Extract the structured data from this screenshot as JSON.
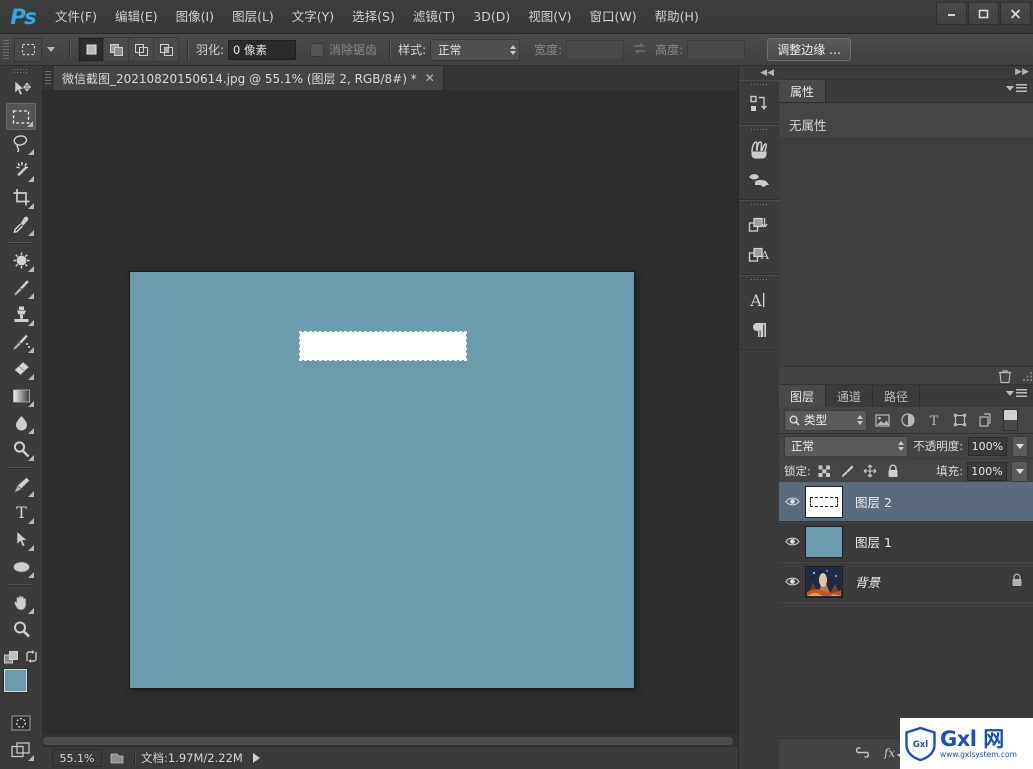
{
  "app": {
    "logo": "Ps",
    "title_menus": [
      {
        "label": "文件(F)",
        "name": "menu-file"
      },
      {
        "label": "编辑(E)",
        "name": "menu-edit"
      },
      {
        "label": "图像(I)",
        "name": "menu-image"
      },
      {
        "label": "图层(L)",
        "name": "menu-layer"
      },
      {
        "label": "文字(Y)",
        "name": "menu-type"
      },
      {
        "label": "选择(S)",
        "name": "menu-select"
      },
      {
        "label": "滤镜(T)",
        "name": "menu-filter"
      },
      {
        "label": "3D(D)",
        "name": "menu-3d"
      },
      {
        "label": "视图(V)",
        "name": "menu-view"
      },
      {
        "label": "窗口(W)",
        "name": "menu-window"
      },
      {
        "label": "帮助(H)",
        "name": "menu-help"
      }
    ],
    "window_buttons": {
      "minimize": "—",
      "maximize": "□",
      "close": "✕"
    }
  },
  "options_bar": {
    "feather_label": "羽化:",
    "feather_value": "0 像素",
    "antialias_label": "消除锯齿",
    "style_label": "样式:",
    "style_value": "正常",
    "width_label": "宽度:",
    "width_value": "",
    "height_label": "高度:",
    "height_value": "",
    "refine_edge_label": "调整边缘 …"
  },
  "document": {
    "tab_title": "微信截图_20210820150614.jpg @ 55.1% (图层 2, RGB/8#) *",
    "tab_close": "✕",
    "canvas_color": "#6b9cae",
    "selection_fill": "#ffffff"
  },
  "status_bar": {
    "zoom": "55.1%",
    "doc_info": "文档:1.97M/2.22M"
  },
  "properties_panel": {
    "tab_label": "属性",
    "empty_text": "无属性"
  },
  "layers_panel": {
    "tabs": [
      {
        "label": "图层",
        "active": true
      },
      {
        "label": "通道",
        "active": false
      },
      {
        "label": "路径",
        "active": false
      }
    ],
    "filter_kind": "类型",
    "blend_mode": "正常",
    "opacity_label": "不透明度:",
    "opacity_value": "100%",
    "lock_label": "锁定:",
    "fill_label": "填充:",
    "fill_value": "100%",
    "layers": [
      {
        "name": "图层 2",
        "selected": true,
        "visible": true,
        "locked": false,
        "thumb": "marquee",
        "italic": false
      },
      {
        "name": "图层 1",
        "selected": false,
        "visible": true,
        "locked": false,
        "thumb": "solid-blue",
        "italic": false
      },
      {
        "name": "背景",
        "selected": false,
        "visible": true,
        "locked": true,
        "thumb": "photo",
        "italic": true
      }
    ]
  },
  "watermark": {
    "badge": "Gxl",
    "main": "Gxl 网",
    "url": "www.gxlsystem.com"
  },
  "colors": {
    "accent": "#31a8e0",
    "panel_bg": "#3b3b3b",
    "canvas_blue": "#6b9cae",
    "selected_layer": "#5a6b7c",
    "watermark_blue": "#1a4fc4"
  },
  "icons": {
    "tools": [
      "move-tool-icon",
      "rectangular-marquee-tool-icon",
      "lasso-tool-icon",
      "magic-wand-tool-icon",
      "crop-tool-icon",
      "eyedropper-tool-icon",
      "spot-healing-tool-icon",
      "brush-tool-icon",
      "clone-stamp-tool-icon",
      "history-brush-tool-icon",
      "eraser-tool-icon",
      "gradient-tool-icon",
      "blur-tool-icon",
      "dodge-tool-icon",
      "pen-tool-icon",
      "type-tool-icon",
      "path-selection-tool-icon",
      "ellipse-shape-tool-icon",
      "hand-tool-icon",
      "zoom-tool-icon"
    ],
    "mini_dock": [
      "history-icon",
      "brush-presets-icon",
      "brush-icon",
      "clone-source-icon",
      "character-styles-icon",
      "paragraph-styles-icon",
      "character-icon",
      "paragraph-icon"
    ]
  }
}
